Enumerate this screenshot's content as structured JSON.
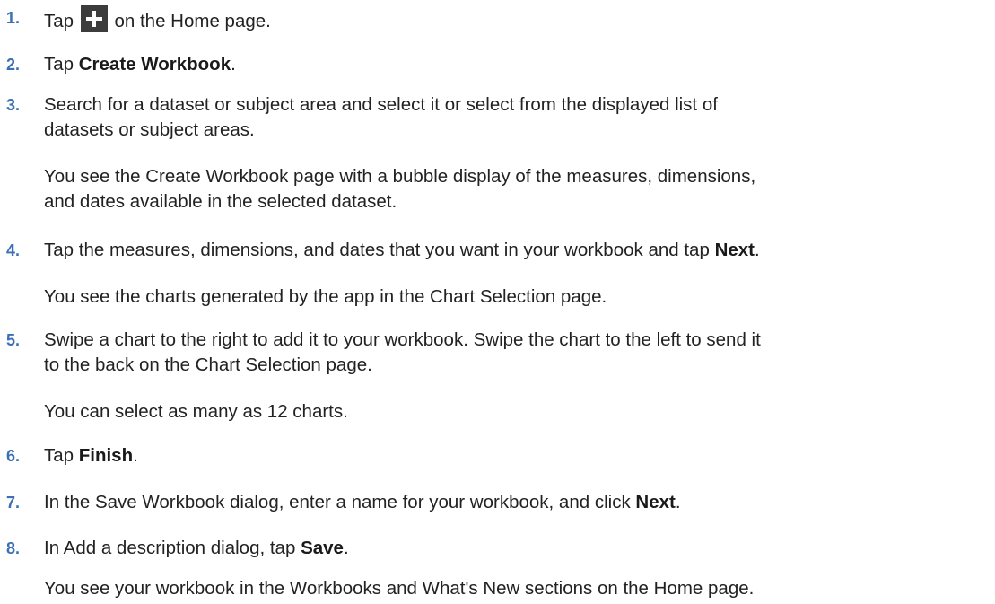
{
  "steps": [
    {
      "num": "1.",
      "pre": "Tap",
      "icon": "plus-icon",
      "post": "on the Home page."
    },
    {
      "num": "2.",
      "pre": "Tap ",
      "bold": "Create Workbook",
      "post": "."
    },
    {
      "num": "3.",
      "line1": "Search for a dataset or subject area and select it or select from the displayed list of",
      "line2": "datasets or subject areas.",
      "note_line1": "You see the Create Workbook page with a bubble display of the measures, dimensions,",
      "note_line2": "and dates available in the selected dataset."
    },
    {
      "num": "4.",
      "pre": "Tap the measures, dimensions, and dates that you want in your workbook and tap ",
      "bold": "Next",
      "post": ".",
      "note": "You see the charts generated by the app in the Chart Selection page."
    },
    {
      "num": "5.",
      "line1": "Swipe a chart to the right to add it to your workbook. Swipe the chart to the left to send it",
      "line2": "to the back on the Chart Selection page.",
      "note": "You can select as many as 12 charts."
    },
    {
      "num": "6.",
      "pre": "Tap ",
      "bold": "Finish",
      "post": "."
    },
    {
      "num": "7.",
      "pre": "In the Save Workbook dialog, enter a name for your workbook, and click ",
      "bold": "Next",
      "post": "."
    },
    {
      "num": "8.",
      "pre": "In Add a description dialog, tap ",
      "bold": "Save",
      "post": ".",
      "note": "You see your workbook in the Workbooks and What's New sections on the Home page."
    }
  ]
}
